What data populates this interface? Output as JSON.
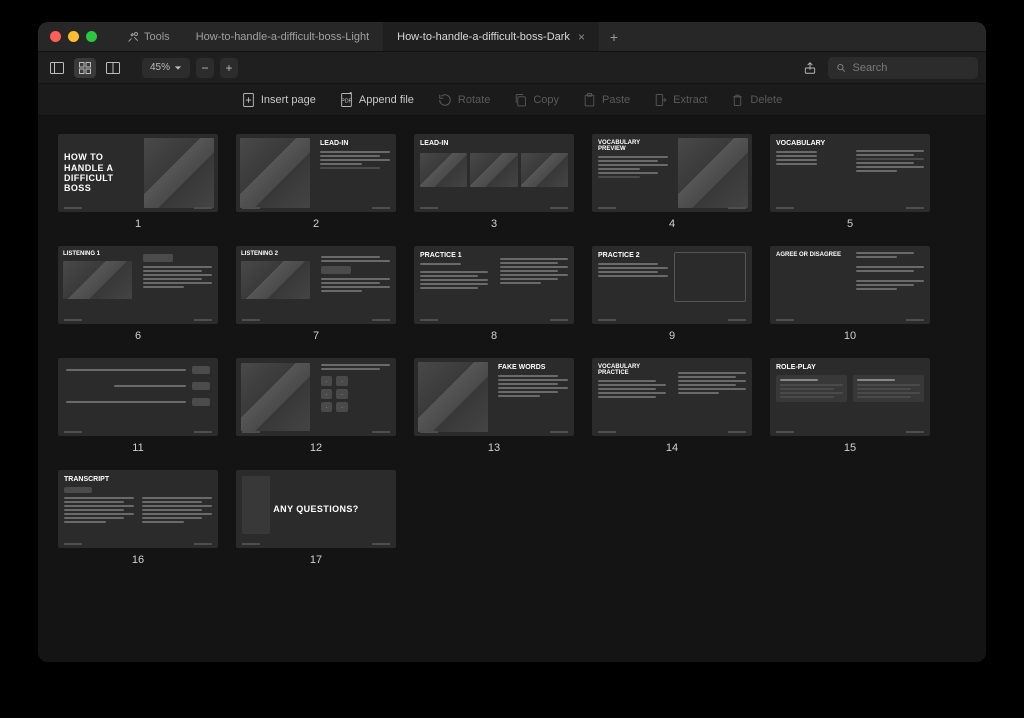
{
  "titlebar": {
    "tools_label": "Tools",
    "tabs": [
      {
        "label": "How-to-handle-a-difficult-boss-Light",
        "active": false
      },
      {
        "label": "How-to-handle-a-difficult-boss-Dark",
        "active": true
      }
    ]
  },
  "toolbar": {
    "zoom_label": "45%",
    "search_placeholder": "Search"
  },
  "actions": {
    "insert_page": "Insert page",
    "append_file": "Append file",
    "rotate": "Rotate",
    "copy": "Copy",
    "paste": "Paste",
    "extract": "Extract",
    "delete": "Delete"
  },
  "slides": [
    {
      "n": "1",
      "title": "HOW TO HANDLE A DIFFICULT BOSS"
    },
    {
      "n": "2",
      "title": "LEAD-IN"
    },
    {
      "n": "3",
      "title": "LEAD-IN"
    },
    {
      "n": "4",
      "title": "VOCABULARY PREVIEW"
    },
    {
      "n": "5",
      "title": "VOCABULARY"
    },
    {
      "n": "6",
      "title": "LISTENING 1"
    },
    {
      "n": "7",
      "title": "LISTENING 2"
    },
    {
      "n": "8",
      "title": "PRACTICE 1"
    },
    {
      "n": "9",
      "title": "PRACTICE 2"
    },
    {
      "n": "10",
      "title": "AGREE OR DISAGREE"
    },
    {
      "n": "11",
      "title": ""
    },
    {
      "n": "12",
      "title": ""
    },
    {
      "n": "13",
      "title": "FAKE WORDS"
    },
    {
      "n": "14",
      "title": "VOCABULARY PRACTICE"
    },
    {
      "n": "15",
      "title": "ROLE-PLAY"
    },
    {
      "n": "16",
      "title": "TRANSCRIPT"
    },
    {
      "n": "17",
      "title": "ANY QUESTIONS?"
    }
  ]
}
